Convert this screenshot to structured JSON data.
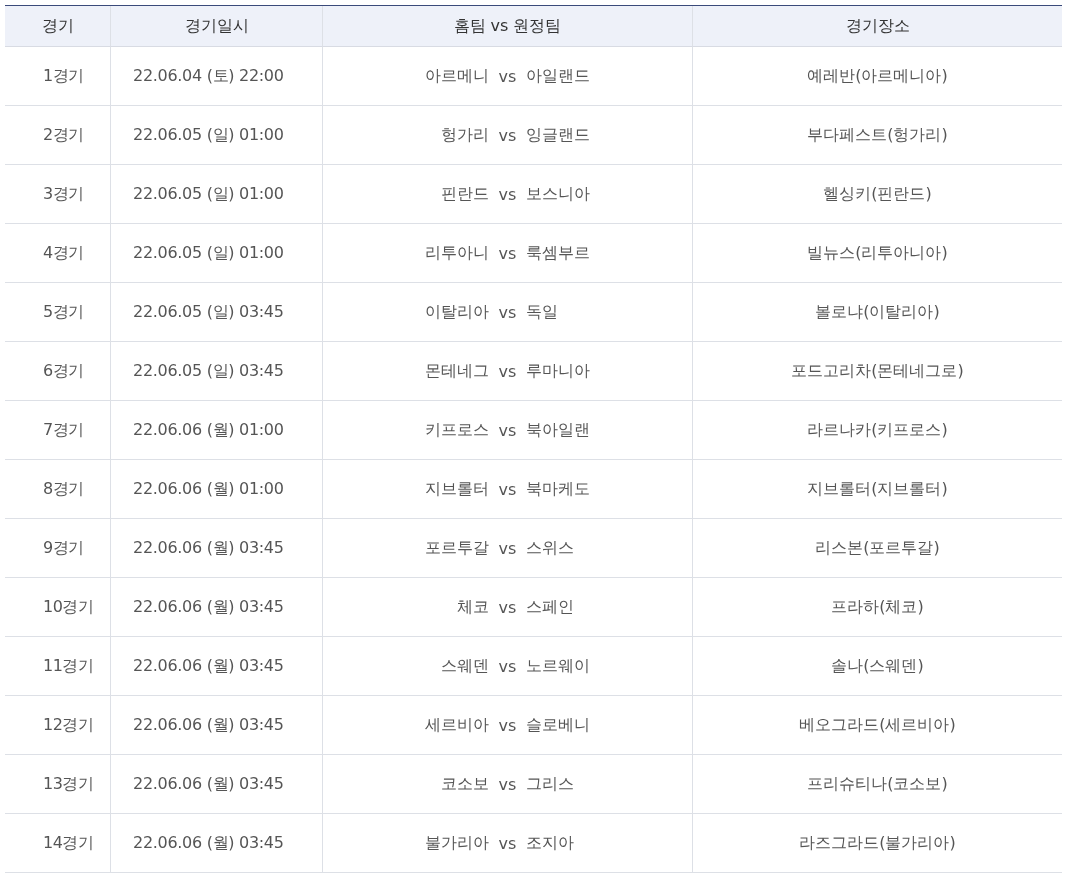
{
  "table": {
    "columns": [
      "경기",
      "경기일시",
      "홈팀 vs 원정팀",
      "경기장소"
    ],
    "rows": [
      {
        "game": "1경기",
        "datetime": "22.06.04 (토) 22:00",
        "home": "아르메니",
        "vs": "vs",
        "away": "아일랜드",
        "venue": "예레반(아르메니아)"
      },
      {
        "game": "2경기",
        "datetime": "22.06.05 (일) 01:00",
        "home": "헝가리",
        "vs": "vs",
        "away": "잉글랜드",
        "venue": "부다페스트(헝가리)"
      },
      {
        "game": "3경기",
        "datetime": "22.06.05 (일) 01:00",
        "home": "핀란드",
        "vs": "vs",
        "away": "보스니아",
        "venue": "헬싱키(핀란드)"
      },
      {
        "game": "4경기",
        "datetime": "22.06.05 (일) 01:00",
        "home": "리투아니",
        "vs": "vs",
        "away": "룩셈부르",
        "venue": "빌뉴스(리투아니아)"
      },
      {
        "game": "5경기",
        "datetime": "22.06.05 (일) 03:45",
        "home": "이탈리아",
        "vs": "vs",
        "away": "독일",
        "venue": "볼로냐(이탈리아)"
      },
      {
        "game": "6경기",
        "datetime": "22.06.05 (일) 03:45",
        "home": "몬테네그",
        "vs": "vs",
        "away": "루마니아",
        "venue": "포드고리차(몬테네그로)"
      },
      {
        "game": "7경기",
        "datetime": "22.06.06 (월) 01:00",
        "home": "키프로스",
        "vs": "vs",
        "away": "북아일랜",
        "venue": "라르나카(키프로스)"
      },
      {
        "game": "8경기",
        "datetime": "22.06.06 (월) 01:00",
        "home": "지브롤터",
        "vs": "vs",
        "away": "북마케도",
        "venue": "지브롤터(지브롤터)"
      },
      {
        "game": "9경기",
        "datetime": "22.06.06 (월) 03:45",
        "home": "포르투갈",
        "vs": "vs",
        "away": "스위스",
        "venue": "리스본(포르투갈)"
      },
      {
        "game": "10경기",
        "datetime": "22.06.06 (월) 03:45",
        "home": "체코",
        "vs": "vs",
        "away": "스페인",
        "venue": "프라하(체코)"
      },
      {
        "game": "11경기",
        "datetime": "22.06.06 (월) 03:45",
        "home": "스웨덴",
        "vs": "vs",
        "away": "노르웨이",
        "venue": "솔나(스웨덴)"
      },
      {
        "game": "12경기",
        "datetime": "22.06.06 (월) 03:45",
        "home": "세르비아",
        "vs": "vs",
        "away": "슬로베니",
        "venue": "베오그라드(세르비아)"
      },
      {
        "game": "13경기",
        "datetime": "22.06.06 (월) 03:45",
        "home": "코소보",
        "vs": "vs",
        "away": "그리스",
        "venue": "프리슈티나(코소보)"
      },
      {
        "game": "14경기",
        "datetime": "22.06.06 (월) 03:45",
        "home": "불가리아",
        "vs": "vs",
        "away": "조지아",
        "venue": "라즈그라드(불가리아)"
      }
    ]
  }
}
